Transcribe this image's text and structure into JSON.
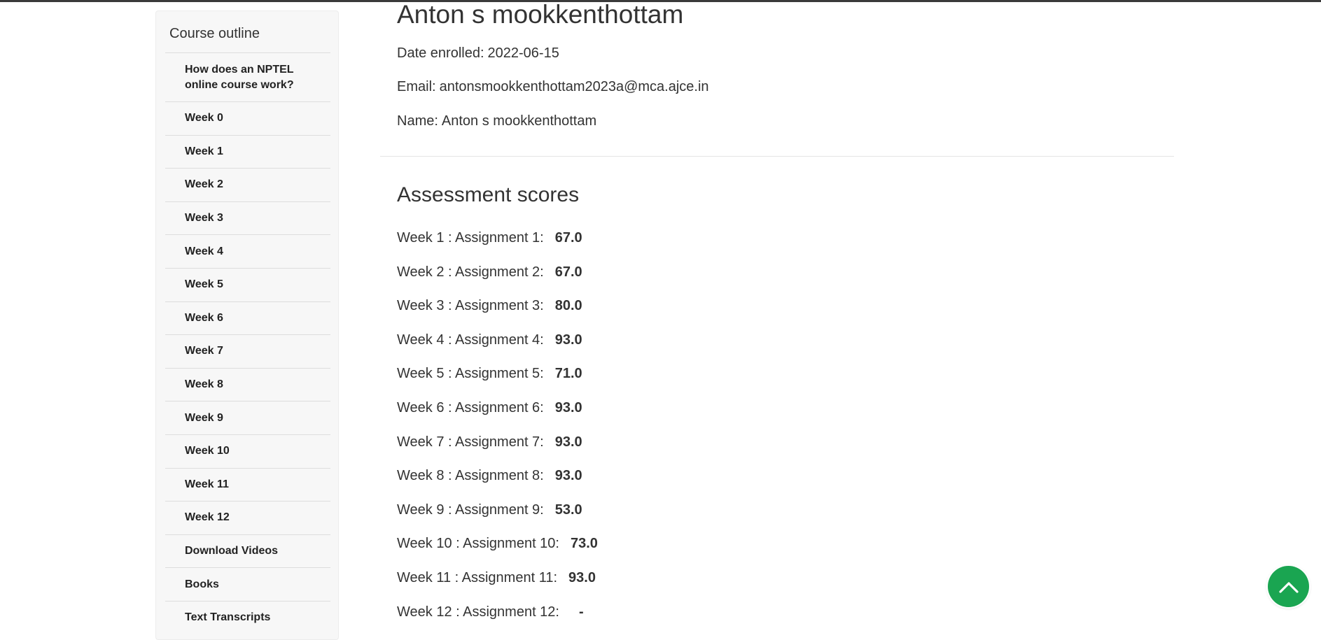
{
  "sidebar": {
    "title": "Course outline",
    "items": [
      {
        "label": "How does an NPTEL online course work?"
      },
      {
        "label": "Week 0"
      },
      {
        "label": "Week 1"
      },
      {
        "label": "Week 2"
      },
      {
        "label": "Week 3"
      },
      {
        "label": "Week 4"
      },
      {
        "label": "Week 5"
      },
      {
        "label": "Week 6"
      },
      {
        "label": "Week 7"
      },
      {
        "label": "Week 8"
      },
      {
        "label": "Week 9"
      },
      {
        "label": "Week 10"
      },
      {
        "label": "Week 11"
      },
      {
        "label": "Week 12"
      },
      {
        "label": "Download Videos"
      },
      {
        "label": "Books"
      },
      {
        "label": "Text Transcripts"
      }
    ]
  },
  "profile": {
    "name": "Anton s mookkenthottam",
    "date_enrolled_label": "Date enrolled:",
    "date_enrolled": "2022-06-15",
    "email_label": "Email:",
    "email": "antonsmookkenthottam2023a@mca.ajce.in",
    "name_label": "Name:",
    "name_value": "Anton s mookkenthottam"
  },
  "assessment": {
    "title": "Assessment scores",
    "scores": [
      {
        "label": "Week 1 : Assignment 1:",
        "value": "67.0"
      },
      {
        "label": "Week 2 : Assignment 2:",
        "value": "67.0"
      },
      {
        "label": "Week 3 : Assignment 3:",
        "value": "80.0"
      },
      {
        "label": "Week 4 : Assignment 4:",
        "value": "93.0"
      },
      {
        "label": "Week 5 : Assignment 5:",
        "value": "71.0"
      },
      {
        "label": "Week 6 : Assignment 6:",
        "value": "93.0"
      },
      {
        "label": "Week 7 : Assignment 7:",
        "value": "93.0"
      },
      {
        "label": "Week 8 : Assignment 8:",
        "value": "93.0"
      },
      {
        "label": "Week 9 : Assignment 9:",
        "value": "53.0"
      },
      {
        "label": "Week 10 : Assignment 10:",
        "value": "73.0"
      },
      {
        "label": "Week 11 : Assignment 11:",
        "value": "93.0"
      },
      {
        "label": "Week 12 : Assignment 12:",
        "value": "-"
      }
    ]
  },
  "back_to_top": {
    "icon": "chevron-up-icon",
    "color": "#1aa551"
  }
}
